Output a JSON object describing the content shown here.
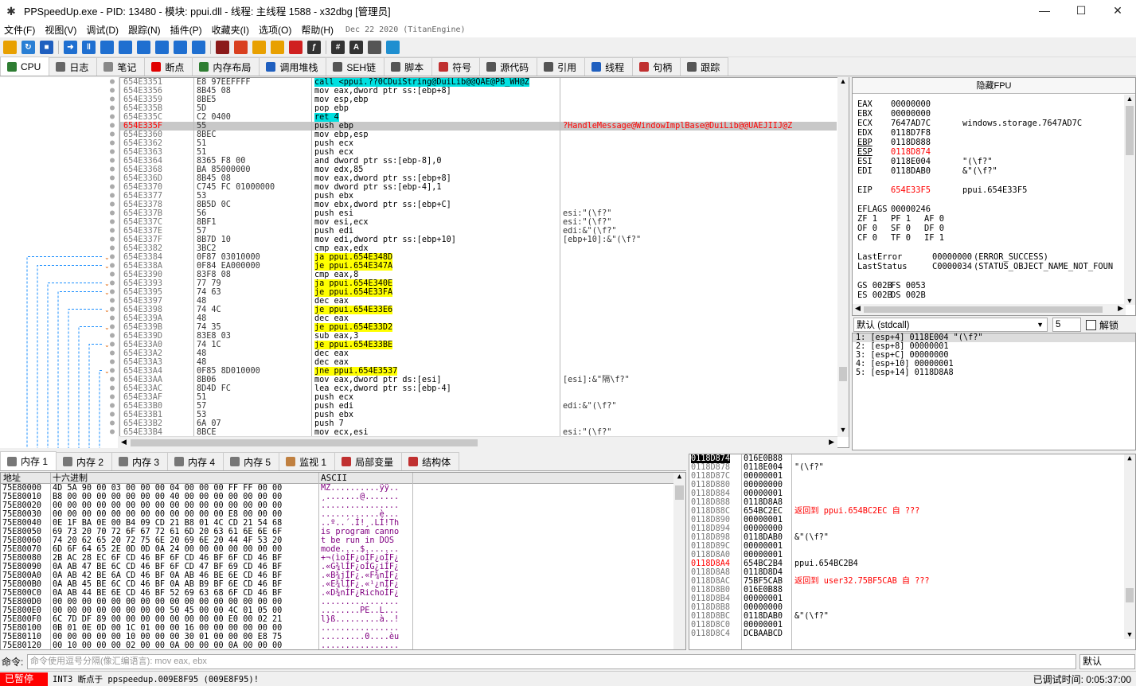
{
  "window": {
    "title": "PPSpeedUp.exe - PID: 13480 - 模块: ppui.dll - 线程: 主线程 1588 - x32dbg [管理员]"
  },
  "menu": {
    "items": [
      "文件(F)",
      "视图(V)",
      "调试(D)",
      "跟踪(N)",
      "插件(P)",
      "收藏夹(I)",
      "选项(O)",
      "帮助(H)"
    ],
    "build_date": "Dec 22 2020 (TitanEngine)"
  },
  "toolbar": {
    "icons": [
      "open-icon",
      "restart-icon",
      "stop-icon",
      "run-icon",
      "pause-icon",
      "step-into-icon",
      "step-over-icon",
      "trace-into-icon",
      "trace-over-icon",
      "execute-till-return-icon",
      "run-to-user-code-icon",
      "scylla-icon",
      "patch-icon",
      "comment-icon",
      "label-icon",
      "bookmark-icon",
      "function-icon",
      "hash-icon",
      "font-icon",
      "calculator-icon",
      "globe-icon"
    ],
    "colors": [
      "#e8a000",
      "#2a7fd4",
      "#1f5fbf",
      "#1f6fd0",
      "#1f6fd0",
      "#1f6fd0",
      "#1f6fd0",
      "#1f6fd0",
      "#1f6fd0",
      "#1f6fd0",
      "#1f6fd0",
      "#8b1a1a",
      "#d94020",
      "#e8a000",
      "#e8a000",
      "#d02020",
      "#333333",
      "#333333",
      "#333333",
      "#555555",
      "#1f8fd0"
    ]
  },
  "tabs": [
    {
      "label": "CPU",
      "icon": "cpu-icon",
      "color": "#2e7d32"
    },
    {
      "label": "日志",
      "icon": "log-icon",
      "color": "#666666"
    },
    {
      "label": "笔记",
      "icon": "notes-icon",
      "color": "#888888"
    },
    {
      "label": "断点",
      "icon": "breakpoint-icon",
      "color": "#e00000"
    },
    {
      "label": "内存布局",
      "icon": "memory-map-icon",
      "color": "#2e7d32"
    },
    {
      "label": "调用堆栈",
      "icon": "call-stack-icon",
      "color": "#1f5fbf"
    },
    {
      "label": "SEH链",
      "icon": "seh-icon",
      "color": "#555555"
    },
    {
      "label": "脚本",
      "icon": "script-icon",
      "color": "#555555"
    },
    {
      "label": "符号",
      "icon": "symbols-icon",
      "color": "#c03030"
    },
    {
      "label": "源代码",
      "icon": "source-icon",
      "color": "#555555"
    },
    {
      "label": "引用",
      "icon": "references-icon",
      "color": "#555555"
    },
    {
      "label": "线程",
      "icon": "threads-icon",
      "color": "#1f5fbf"
    },
    {
      "label": "句柄",
      "icon": "handles-icon",
      "color": "#c03030"
    },
    {
      "label": "跟踪",
      "icon": "trace-icon",
      "color": "#555555"
    }
  ],
  "disasm": [
    {
      "addr": "654E3351",
      "bytes": "E8 97EEFFFF",
      "instr": "call <ppui.??0CDuiString@DuiLib@@QAE@PB_WH@Z",
      "cmt": "",
      "hl": "call"
    },
    {
      "addr": "654E3356",
      "bytes": "8B45 08",
      "instr": "mov eax,dword ptr ss:[ebp+8]",
      "cmt": "",
      "hl": ""
    },
    {
      "addr": "654E3359",
      "bytes": "8BE5",
      "instr": "mov esp,ebp",
      "cmt": "",
      "hl": ""
    },
    {
      "addr": "654E335B",
      "bytes": "5D",
      "instr": "pop ebp",
      "cmt": "",
      "hl": ""
    },
    {
      "addr": "654E335C",
      "bytes": "C2 0400",
      "instr": "ret 4",
      "cmt": "",
      "hl": "call"
    },
    {
      "addr": "654E335F",
      "bytes": "55",
      "instr": "push ebp",
      "cmt": "?HandleMessage@WindowImplBase@DuiLib@@UAEJIIJ@Z",
      "hl": "",
      "cur": true
    },
    {
      "addr": "654E3360",
      "bytes": "8BEC",
      "instr": "mov ebp,esp",
      "cmt": "",
      "hl": ""
    },
    {
      "addr": "654E3362",
      "bytes": "51",
      "instr": "push ecx",
      "cmt": "",
      "hl": ""
    },
    {
      "addr": "654E3363",
      "bytes": "51",
      "instr": "push ecx",
      "cmt": "",
      "hl": ""
    },
    {
      "addr": "654E3364",
      "bytes": "8365 F8 00",
      "instr": "and dword ptr ss:[ebp-8],0",
      "cmt": "",
      "hl": ""
    },
    {
      "addr": "654E3368",
      "bytes": "BA 85000000",
      "instr": "mov edx,85",
      "cmt": "",
      "hl": ""
    },
    {
      "addr": "654E336D",
      "bytes": "8B45 08",
      "instr": "mov eax,dword ptr ss:[ebp+8]",
      "cmt": "",
      "hl": ""
    },
    {
      "addr": "654E3370",
      "bytes": "C745 FC 01000000",
      "instr": "mov dword ptr ss:[ebp-4],1",
      "cmt": "",
      "hl": ""
    },
    {
      "addr": "654E3377",
      "bytes": "53",
      "instr": "push ebx",
      "cmt": "",
      "hl": ""
    },
    {
      "addr": "654E3378",
      "bytes": "8B5D 0C",
      "instr": "mov ebx,dword ptr ss:[ebp+C]",
      "cmt": "",
      "hl": ""
    },
    {
      "addr": "654E337B",
      "bytes": "56",
      "instr": "push esi",
      "cmt": "esi:\"(\\f?\"",
      "hl": ""
    },
    {
      "addr": "654E337C",
      "bytes": "8BF1",
      "instr": "mov esi,ecx",
      "cmt": "esi:\"(\\f?\"",
      "hl": ""
    },
    {
      "addr": "654E337E",
      "bytes": "57",
      "instr": "push edi",
      "cmt": "edi:&\"(\\f?\"",
      "hl": ""
    },
    {
      "addr": "654E337F",
      "bytes": "8B7D 10",
      "instr": "mov edi,dword ptr ss:[ebp+10]",
      "cmt": "[ebp+10]:&\"(\\f?\"",
      "hl": ""
    },
    {
      "addr": "654E3382",
      "bytes": "3BC2",
      "instr": "cmp eax,edx",
      "cmt": "",
      "hl": ""
    },
    {
      "addr": "654E3384",
      "bytes": "0F87 03010000",
      "instr": "ja ppui.654E348D",
      "cmt": "",
      "hl": "jmp",
      "arrow": true
    },
    {
      "addr": "654E338A",
      "bytes": "0F84 EA000000",
      "instr": "je ppui.654E347A",
      "cmt": "",
      "hl": "jmp",
      "arrow": true
    },
    {
      "addr": "654E3390",
      "bytes": "83F8 08",
      "instr": "cmp eax,8",
      "cmt": "",
      "hl": ""
    },
    {
      "addr": "654E3393",
      "bytes": "77 79",
      "instr": "ja ppui.654E340E",
      "cmt": "",
      "hl": "jmp",
      "arrow": true
    },
    {
      "addr": "654E3395",
      "bytes": "74 63",
      "instr": "je ppui.654E33FA",
      "cmt": "",
      "hl": "jmp",
      "arrow": true
    },
    {
      "addr": "654E3397",
      "bytes": "48",
      "instr": "dec eax",
      "cmt": "",
      "hl": ""
    },
    {
      "addr": "654E3398",
      "bytes": "74 4C",
      "instr": "je ppui.654E33E6",
      "cmt": "",
      "hl": "jmp",
      "arrow": true
    },
    {
      "addr": "654E339A",
      "bytes": "48",
      "instr": "dec eax",
      "cmt": "",
      "hl": ""
    },
    {
      "addr": "654E339B",
      "bytes": "74 35",
      "instr": "je ppui.654E33D2",
      "cmt": "",
      "hl": "jmp",
      "arrow": true
    },
    {
      "addr": "654E339D",
      "bytes": "83E8 03",
      "instr": "sub eax,3",
      "cmt": "",
      "hl": ""
    },
    {
      "addr": "654E33A0",
      "bytes": "74 1C",
      "instr": "je ppui.654E33BE",
      "cmt": "",
      "hl": "jmp",
      "arrow": true
    },
    {
      "addr": "654E33A2",
      "bytes": "48",
      "instr": "dec eax",
      "cmt": "",
      "hl": ""
    },
    {
      "addr": "654E33A3",
      "bytes": "48",
      "instr": "dec eax",
      "cmt": "",
      "hl": ""
    },
    {
      "addr": "654E33A4",
      "bytes": "0F85 8D010000",
      "instr": "jne ppui.654E3537",
      "cmt": "",
      "hl": "jmp",
      "arrow": true
    },
    {
      "addr": "654E33AA",
      "bytes": "8B06",
      "instr": "mov eax,dword ptr ds:[esi]",
      "cmt": "[esi]:&\"隔\\f?\"",
      "hl": ""
    },
    {
      "addr": "654E33AC",
      "bytes": "8D4D FC",
      "instr": "lea ecx,dword ptr ss:[ebp-4]",
      "cmt": "",
      "hl": ""
    },
    {
      "addr": "654E33AF",
      "bytes": "51",
      "instr": "push ecx",
      "cmt": "",
      "hl": ""
    },
    {
      "addr": "654E33B0",
      "bytes": "57",
      "instr": "push edi",
      "cmt": "edi:&\"(\\f?\"",
      "hl": ""
    },
    {
      "addr": "654E33B1",
      "bytes": "53",
      "instr": "push ebx",
      "cmt": "",
      "hl": ""
    },
    {
      "addr": "654E33B2",
      "bytes": "6A 07",
      "instr": "push 7",
      "cmt": "",
      "hl": ""
    },
    {
      "addr": "654E33B4",
      "bytes": "8BCE",
      "instr": "mov ecx,esi",
      "cmt": "esi:\"(\\f?\"",
      "hl": ""
    }
  ],
  "registers": {
    "fpu_button": "隐藏FPU",
    "rows": [
      {
        "n": "EAX",
        "v": "00000000",
        "d": ""
      },
      {
        "n": "EBX",
        "v": "00000000",
        "d": ""
      },
      {
        "n": "ECX",
        "v": "7647AD7C",
        "d": "windows.storage.7647AD7C"
      },
      {
        "n": "EDX",
        "v": "0118D7F8",
        "d": ""
      },
      {
        "n": "EBP",
        "v": "0118D888",
        "d": "",
        "u": true
      },
      {
        "n": "ESP",
        "v": "0118D874",
        "d": "",
        "u": true,
        "red": true
      },
      {
        "n": "ESI",
        "v": "0118E004",
        "d": "\"(\\f?\""
      },
      {
        "n": "EDI",
        "v": "0118DAB0",
        "d": "&\"(\\f?\""
      },
      {
        "n": "",
        "v": "",
        "d": ""
      },
      {
        "n": "EIP",
        "v": "654E33F5",
        "d": "ppui.654E33F5",
        "red": true
      },
      {
        "n": "",
        "v": "",
        "d": ""
      },
      {
        "n": "EFLAGS",
        "v": "00000246",
        "d": ""
      },
      {
        "n": "ZF 1",
        "v": "PF 1",
        "d": "AF 0"
      },
      {
        "n": "OF 0",
        "v": "SF 0",
        "d": "DF 0"
      },
      {
        "n": "CF 0",
        "v": "TF 0",
        "d": "IF 1"
      },
      {
        "n": "",
        "v": "",
        "d": ""
      },
      {
        "n": "LastError",
        "v": "00000000",
        "d": "(ERROR_SUCCESS)"
      },
      {
        "n": "LastStatus",
        "v": "C0000034",
        "d": "(STATUS_OBJECT_NAME_NOT_FOUN"
      },
      {
        "n": "",
        "v": "",
        "d": ""
      },
      {
        "n": "GS 002B",
        "v": "FS 0053",
        "d": ""
      },
      {
        "n": "ES 002B",
        "v": "DS 002B",
        "d": ""
      }
    ]
  },
  "callconv": {
    "value": "默认 (stdcall)",
    "count": "5",
    "unlock_label": "解锁"
  },
  "args": [
    "1: [esp+4] 0118E004 \"(\\f?\"",
    "2: [esp+8] 00000001",
    "3: [esp+C] 00000000",
    "4: [esp+10] 00000001",
    "5: [esp+14] 0118D8A8"
  ],
  "bottom_tabs": [
    {
      "label": "内存 1",
      "icon": "memory-icon"
    },
    {
      "label": "内存 2",
      "icon": "memory-icon"
    },
    {
      "label": "内存 3",
      "icon": "memory-icon"
    },
    {
      "label": "内存 4",
      "icon": "memory-icon"
    },
    {
      "label": "内存 5",
      "icon": "memory-icon"
    },
    {
      "label": "监视 1",
      "icon": "watch-icon"
    },
    {
      "label": "局部变量",
      "icon": "locals-icon"
    },
    {
      "label": "结构体",
      "icon": "struct-icon"
    }
  ],
  "dump": {
    "headers": {
      "addr": "地址",
      "hex": "十六进制",
      "ascii": "ASCII"
    },
    "rows": [
      {
        "a": "75E80000",
        "h": "4D 5A 90 00 03 00 00 00 04 00 00 00 FF FF 00 00",
        "t": "MZ..........ÿÿ.."
      },
      {
        "a": "75E80010",
        "h": "B8 00 00 00 00 00 00 00 40 00 00 00 00 00 00 00",
        "t": "¸.......@......."
      },
      {
        "a": "75E80020",
        "h": "00 00 00 00 00 00 00 00 00 00 00 00 00 00 00 00",
        "t": "................"
      },
      {
        "a": "75E80030",
        "h": "00 00 00 00 00 00 00 00 00 00 00 00 E8 00 00 00",
        "t": "............è..."
      },
      {
        "a": "75E80040",
        "h": "0E 1F BA 0E 00 B4 09 CD 21 B8 01 4C CD 21 54 68",
        "t": "..º..´.Í!¸.LÍ!Th"
      },
      {
        "a": "75E80050",
        "h": "69 73 20 70 72 6F 67 72 61 6D 20 63 61 6E 6E 6F",
        "t": "is program canno"
      },
      {
        "a": "75E80060",
        "h": "74 20 62 65 20 72 75 6E 20 69 6E 20 44 4F 53 20",
        "t": "t be run in DOS "
      },
      {
        "a": "75E80070",
        "h": "6D 6F 64 65 2E 0D 0D 0A 24 00 00 00 00 00 00 00",
        "t": "mode....$......."
      },
      {
        "a": "75E80080",
        "h": "2B AC 28 EC 6F CD 46 BF 6F CD 46 BF 6F CD 46 BF",
        "t": "+¬(ìoÍF¿oÍF¿oÍF¿"
      },
      {
        "a": "75E80090",
        "h": "0A AB 47 BE 6C CD 46 BF 6F CD 47 BF 69 CD 46 BF",
        "t": ".«G¾lÍF¿oÍG¿iÍF¿"
      },
      {
        "a": "75E800A0",
        "h": "0A AB 42 BE 6A CD 46 BF 0A AB 46 BE 6E CD 46 BF",
        "t": ".«B¾jÍF¿.«F¾nÍF¿"
      },
      {
        "a": "75E800B0",
        "h": "0A AB 45 BE 6C CD 46 BF 0A AB B9 BF 6E CD 46 BF",
        "t": ".«E¾lÍF¿.«¹¿nÍF¿"
      },
      {
        "a": "75E800C0",
        "h": "0A AB 44 BE 6E CD 46 BF 52 69 63 68 6F CD 46 BF",
        "t": ".«D¾nÍF¿RichoÍF¿"
      },
      {
        "a": "75E800D0",
        "h": "00 00 00 00 00 00 00 00 00 00 00 00 00 00 00 00",
        "t": "................"
      },
      {
        "a": "75E800E0",
        "h": "00 00 00 00 00 00 00 00 50 45 00 00 4C 01 05 00",
        "t": "........PE..L..."
      },
      {
        "a": "75E800F0",
        "h": "6C 7D DF 89 00 00 00 00 00 00 00 00 E0 00 02 21",
        "t": "l}ß.........à..!"
      },
      {
        "a": "75E80100",
        "h": "0B 01 0E 0D 00 1C 01 00 00 16 00 00 00 00 00 00",
        "t": "................"
      },
      {
        "a": "75E80110",
        "h": "00 00 00 00 00 10 00 00 00 30 01 00 00 00 E8 75",
        "t": ".........0....èu"
      },
      {
        "a": "75E80120",
        "h": "00 10 00 00 00 02 00 00 0A 00 00 00 0A 00 00 00",
        "t": "................"
      }
    ]
  },
  "stack": [
    {
      "a": "0118D874",
      "v": "016E0B88",
      "c": "",
      "top": true
    },
    {
      "a": "0118D878",
      "v": "0118E004",
      "c": "\"(\\f?\""
    },
    {
      "a": "0118D87C",
      "v": "00000001",
      "c": ""
    },
    {
      "a": "0118D880",
      "v": "00000000",
      "c": ""
    },
    {
      "a": "0118D884",
      "v": "00000001",
      "c": ""
    },
    {
      "a": "0118D888",
      "v": "0118D8A8",
      "c": ""
    },
    {
      "a": "0118D88C",
      "v": "654BC2EC",
      "c": "返回到 ppui.654BC2EC 自 ???",
      "red": true
    },
    {
      "a": "0118D890",
      "v": "00000001",
      "c": ""
    },
    {
      "a": "0118D894",
      "v": "00000000",
      "c": ""
    },
    {
      "a": "0118D898",
      "v": "0118DAB0",
      "c": "&\"(\\f?\""
    },
    {
      "a": "0118D89C",
      "v": "00000001",
      "c": ""
    },
    {
      "a": "0118D8A0",
      "v": "00000001",
      "c": ""
    },
    {
      "a": "0118D8A4",
      "v": "654BC2B4",
      "c": "ppui.654BC2B4",
      "redaddr": true
    },
    {
      "a": "0118D8A8",
      "v": "0118D8D4",
      "c": ""
    },
    {
      "a": "0118D8AC",
      "v": "75BF5CAB",
      "c": "返回到 user32.75BF5CAB 自 ???",
      "red": true
    },
    {
      "a": "0118D8B0",
      "v": "016E0B88",
      "c": ""
    },
    {
      "a": "0118D8B4",
      "v": "00000001",
      "c": ""
    },
    {
      "a": "0118D8B8",
      "v": "00000000",
      "c": ""
    },
    {
      "a": "0118D8BC",
      "v": "0118DAB0",
      "c": "&\"(\\f?\""
    },
    {
      "a": "0118D8C0",
      "v": "00000001",
      "c": ""
    },
    {
      "a": "0118D8C4",
      "v": "DCBAABCD",
      "c": ""
    }
  ],
  "command": {
    "label": "命令:",
    "placeholder": "命令使用逗号分隔(像汇编语言): mov eax, ebx",
    "mode": "默认"
  },
  "status": {
    "state": "已暂停",
    "message": "INT3 断点于 ppspeedup.009E8F95 (009E8F95)!",
    "time": "已调试时间:  0:05:37:00"
  }
}
